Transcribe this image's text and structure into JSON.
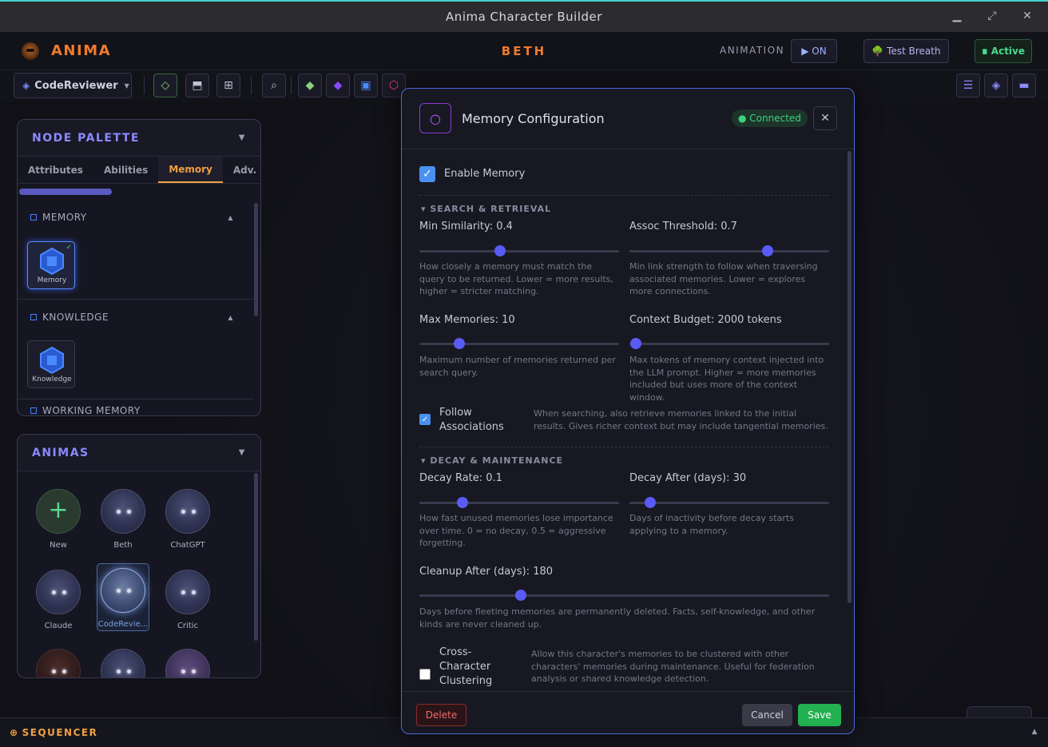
{
  "window": {
    "title": "Anima Character Builder"
  },
  "header": {
    "logo": "ANIMA",
    "character": "BETH",
    "animation_label": "ANIMATION",
    "animation_button": "▶ ON",
    "test_breath_button": "🌳 Test Breath",
    "active_button": "∎ Active"
  },
  "toolbar": {
    "character_select": "CodeReviewer"
  },
  "node_palette": {
    "title": "NODE PALETTE",
    "tabs": [
      "Attributes",
      "Abilities",
      "Memory",
      "Adv. Cog"
    ],
    "active_tab": "Memory",
    "categories": [
      {
        "name": "MEMORY",
        "nodes": [
          "Memory"
        ]
      },
      {
        "name": "KNOWLEDGE",
        "nodes": [
          "Knowledge"
        ]
      },
      {
        "name": "WORKING MEMORY",
        "nodes": []
      }
    ]
  },
  "animas": {
    "title": "ANIMAS",
    "items": [
      "New",
      "Beth",
      "ChatGPT",
      "Claude",
      "CodeRevie...",
      "Critic"
    ],
    "selected": "CodeRevie..."
  },
  "sequencer": {
    "label": "SEQUENCER"
  },
  "modal": {
    "title": "Memory Configuration",
    "status": "● Connected",
    "enable_label": "Enable Memory",
    "enable_checked": true,
    "sections": {
      "search": "SEARCH & RETRIEVAL",
      "decay": "DECAY & MAINTENANCE"
    },
    "sliders": {
      "min_similarity": {
        "label": "Min Similarity: 0.4",
        "value": 0.4,
        "desc": "How closely a memory must match the query to be returned. Lower = more results, higher = stricter matching."
      },
      "assoc_threshold": {
        "label": "Assoc Threshold: 0.7",
        "value": 0.7,
        "desc": "Min link strength to follow when traversing associated memories. Lower = explores more connections."
      },
      "max_memories": {
        "label": "Max Memories: 10",
        "value": 10,
        "desc": "Maximum number of memories returned per search query."
      },
      "context_budget": {
        "label": "Context Budget: 2000 tokens",
        "value": 2000,
        "desc": "Max tokens of memory context injected into the LLM prompt. Higher = more memories included but uses more of the context window."
      },
      "decay_rate": {
        "label": "Decay Rate: 0.1",
        "value": 0.1,
        "desc": "How fast unused memories lose importance over time. 0 = no decay, 0.5 = aggressive forgetting."
      },
      "decay_after": {
        "label": "Decay After (days): 30",
        "value": 30,
        "desc": "Days of inactivity before decay starts applying to a memory."
      },
      "cleanup_after": {
        "label": "Cleanup After (days): 180",
        "value": 180,
        "desc": "Days before fleeting memories are permanently deleted. Facts, self-knowledge, and other kinds are never cleaned up."
      }
    },
    "follow_assoc": {
      "label_1": "Follow",
      "label_2": "Associations",
      "checked": true,
      "desc": "When searching, also retrieve memories linked to the initial results. Gives richer context but may include tangential memories."
    },
    "cross_char": {
      "label_1": "Cross-",
      "label_2": "Character",
      "label_3": "Clustering",
      "checked": false,
      "desc": "Allow this character's memories to be clustered with other characters' memories during maintenance. Useful for federation analysis or shared knowledge detection."
    },
    "buttons": {
      "delete": "Delete",
      "cancel": "Cancel",
      "save": "Save"
    }
  },
  "colors": {
    "accent": "#f07a2c",
    "primary": "#5a5af5",
    "success": "#22b050",
    "danger": "#f06a6a"
  }
}
